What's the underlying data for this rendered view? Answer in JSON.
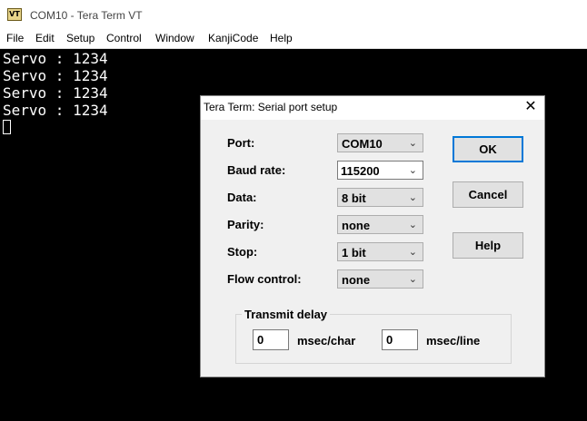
{
  "window": {
    "title": "COM10 - Tera Term VT",
    "icon": "VT"
  },
  "menu": [
    "File",
    "Edit",
    "Setup",
    "Control",
    "Window",
    "KanjiCode",
    "Help"
  ],
  "terminal": {
    "lines": [
      "Servo : 1234",
      "Servo : 1234",
      "Servo : 1234",
      "Servo : 1234"
    ]
  },
  "dialog": {
    "title": "Tera Term: Serial port setup",
    "close": "✕",
    "port": {
      "label": "Port:",
      "value": "COM10"
    },
    "baud": {
      "label": "Baud rate:",
      "value": "115200"
    },
    "data": {
      "label": "Data:",
      "value": "8 bit"
    },
    "parity": {
      "label": "Parity:",
      "value": "none"
    },
    "stop": {
      "label": "Stop:",
      "value": "1 bit"
    },
    "flow": {
      "label": "Flow control:",
      "value": "none"
    },
    "buttons": {
      "ok": "OK",
      "cancel": "Cancel",
      "help": "Help"
    },
    "transmit": {
      "label": "Transmit delay",
      "char_value": "0",
      "char_unit": "msec/char",
      "line_value": "0",
      "line_unit": "msec/line"
    }
  }
}
